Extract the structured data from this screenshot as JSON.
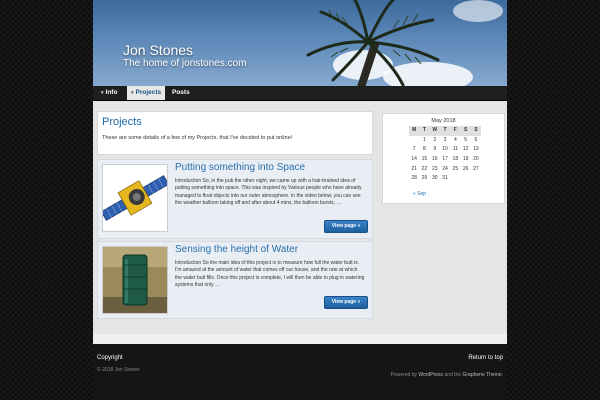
{
  "header": {
    "site_title": "Jon Stones",
    "site_description": "The home of jonstones.com"
  },
  "nav": {
    "items": [
      {
        "label": "Info",
        "has_submenu": true
      },
      {
        "label": "Projects",
        "has_submenu": true,
        "active": true
      },
      {
        "label": "Posts",
        "has_submenu": false
      }
    ]
  },
  "page": {
    "title": "Projects",
    "intro": "These are some details of a few of my Projects, that I've decided to put online!"
  },
  "posts": [
    {
      "title": "Putting something into Space",
      "excerpt": "Introduction So, in the pub the other night, we came up with a hair-brained idea of putting something into space. This was inspired by Various people who have already managed to float objects into our outer atmosphere. In the video below, you can see the weather balloon taking off and after about 4 mins, the balloon bursts, …",
      "button": "View page »",
      "thumb": "satellite-image"
    },
    {
      "title": "Sensing the height of Water",
      "excerpt": "Introduction So the main idea of this project is to measure how full the water butt is. I'm amazed at the amount of water that comes off our house, and the rate at which the water butt fills. Once this project is complete, I will then be able to plug in watering systems that only …",
      "button": "View page »",
      "thumb": "water-butt-image"
    }
  ],
  "calendar": {
    "caption": "May 2018",
    "weekdays": [
      "M",
      "T",
      "W",
      "T",
      "F",
      "S",
      "S"
    ],
    "weeks": [
      [
        "",
        "1",
        "2",
        "3",
        "4",
        "5",
        "6"
      ],
      [
        "7",
        "8",
        "9",
        "10",
        "11",
        "12",
        "13"
      ],
      [
        "14",
        "15",
        "16",
        "17",
        "18",
        "19",
        "20"
      ],
      [
        "21",
        "22",
        "23",
        "24",
        "25",
        "26",
        "27"
      ],
      [
        "28",
        "29",
        "30",
        "31",
        "",
        "",
        ""
      ]
    ],
    "prev": "« Sep"
  },
  "footer": {
    "copyright_title": "Copyright",
    "copyright_text": "© 2018 Jon Stones",
    "return_top": "Return to top",
    "credit_pre": "Powered by ",
    "credit_wp": "WordPress",
    "credit_mid": " and the ",
    "credit_theme": "Graphene Theme",
    "credit_post": "."
  },
  "colors": {
    "accent": "#1e6aa8",
    "button": "#1e5f9e",
    "background": "#141414"
  }
}
